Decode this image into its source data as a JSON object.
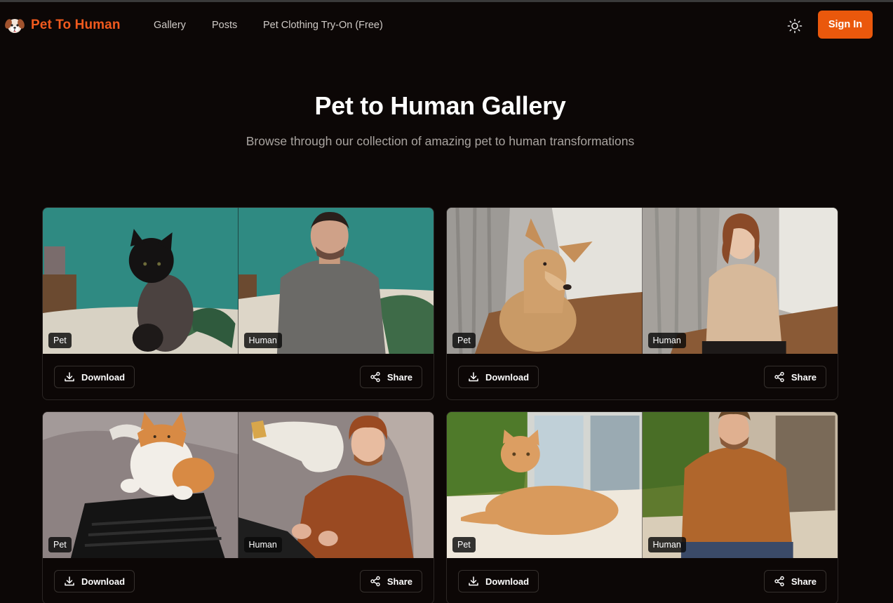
{
  "brand": {
    "name": "Pet To Human",
    "logo_icon": "dog-face-icon"
  },
  "nav": {
    "links": [
      "Gallery",
      "Posts",
      "Pet Clothing Try-On (Free)"
    ],
    "theme_icon": "sun-icon",
    "sign_in_label": "Sign In"
  },
  "hero": {
    "title": "Pet to Human Gallery",
    "subtitle": "Browse through our collection of amazing pet to human transformations"
  },
  "labels": {
    "pet": "Pet",
    "human": "Human",
    "download": "Download",
    "share": "Share",
    "download_icon": "download-icon",
    "share_icon": "share-icon"
  },
  "colors": {
    "accent": "#ea580c",
    "brand_text": "#f05a1e",
    "background": "#0c0706",
    "border": "#2b2624"
  },
  "gallery": [
    {
      "pet_image": "black cat on bed in front of teal wall",
      "human_image": "man in grey t-shirt on bed in front of teal wall"
    },
    {
      "pet_image": "tan dog by white curtain",
      "human_image": "woman in beige t-shirt by white curtain"
    },
    {
      "pet_image": "orange and white cat on laptop",
      "human_image": "man in rust sweater with laptop"
    },
    {
      "pet_image": "orange tabby cat lying by sunny window",
      "human_image": "man in brown t-shirt by sunny window"
    }
  ]
}
